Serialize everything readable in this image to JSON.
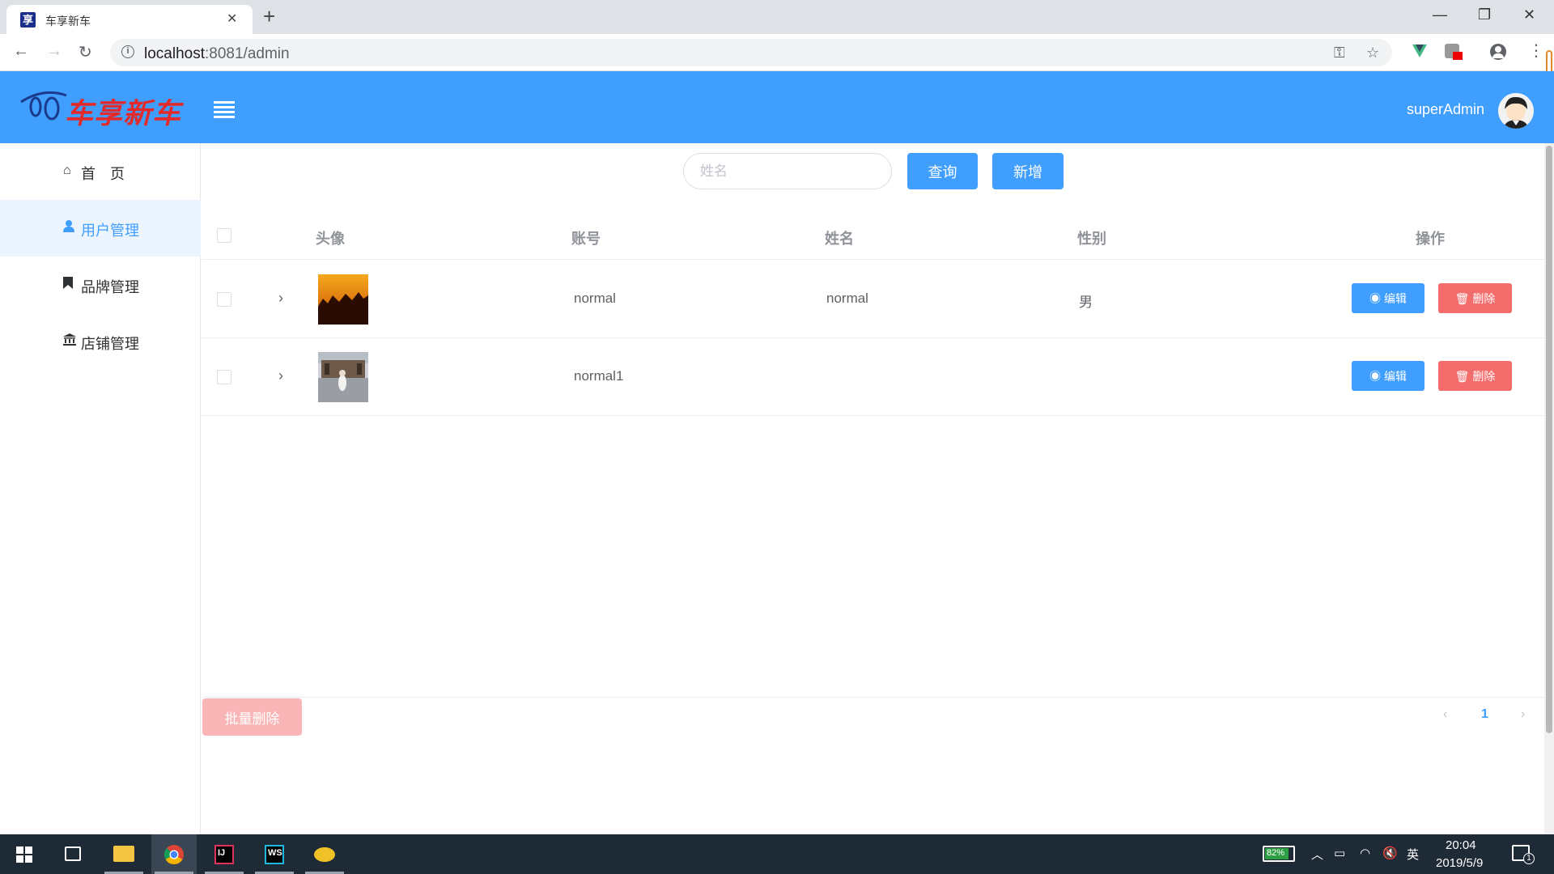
{
  "browser": {
    "tab_title": "车享新车",
    "tab_favicon": "享",
    "url_host": "localhost",
    "url_path": ":8081/admin"
  },
  "header": {
    "logo_text": "车享新车",
    "username": "superAdmin",
    "accent_color": "#409eff"
  },
  "sidebar": {
    "items": [
      {
        "label": "首　页",
        "icon": "home-icon"
      },
      {
        "label": "用户管理",
        "icon": "user-icon"
      },
      {
        "label": "品牌管理",
        "icon": "bookmark-icon"
      },
      {
        "label": "店铺管理",
        "icon": "bank-icon"
      }
    ],
    "active_index": 1
  },
  "toolbar": {
    "search_placeholder": "姓名",
    "query_label": "查询",
    "add_label": "新增"
  },
  "table": {
    "columns": [
      "头像",
      "账号",
      "姓名",
      "性别",
      "操作"
    ],
    "rows": [
      {
        "account": "normal",
        "name": "normal",
        "gender": "男"
      },
      {
        "account": "normal1",
        "name": "",
        "gender": ""
      }
    ],
    "edit_label": "编辑",
    "delete_label": "删除"
  },
  "footer": {
    "batch_delete_label": "批量删除",
    "current_page": "1"
  },
  "taskbar": {
    "battery": "82%",
    "ime": "英",
    "time": "20:04",
    "date": "2019/5/9",
    "notifications": "1"
  }
}
